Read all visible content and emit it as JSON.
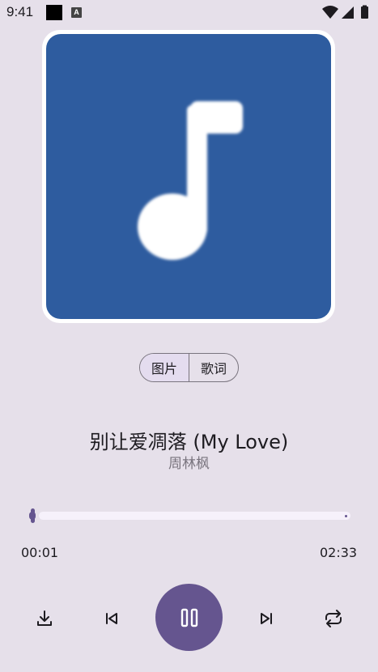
{
  "status_bar": {
    "time": "9:41",
    "a_badge": "A",
    "icons": [
      "wifi-icon",
      "cellular-icon",
      "battery-icon"
    ]
  },
  "player": {
    "album_art_icon": "music-note-icon",
    "colors": {
      "accent": "#65558f",
      "album_bg": "#2e5c9f",
      "background": "#e6e0ea"
    },
    "view_toggle": {
      "picture_label": "图片",
      "lyrics_label": "歌词",
      "selected": "图片"
    },
    "song_title": "别让爱凋落 (My Love)",
    "artist": "周林枫",
    "progress": 0.007,
    "current_time": "00:01",
    "total_time": "02:33",
    "controls": [
      "download-icon",
      "previous-icon",
      "pause-icon",
      "next-icon",
      "repeat-icon"
    ]
  }
}
